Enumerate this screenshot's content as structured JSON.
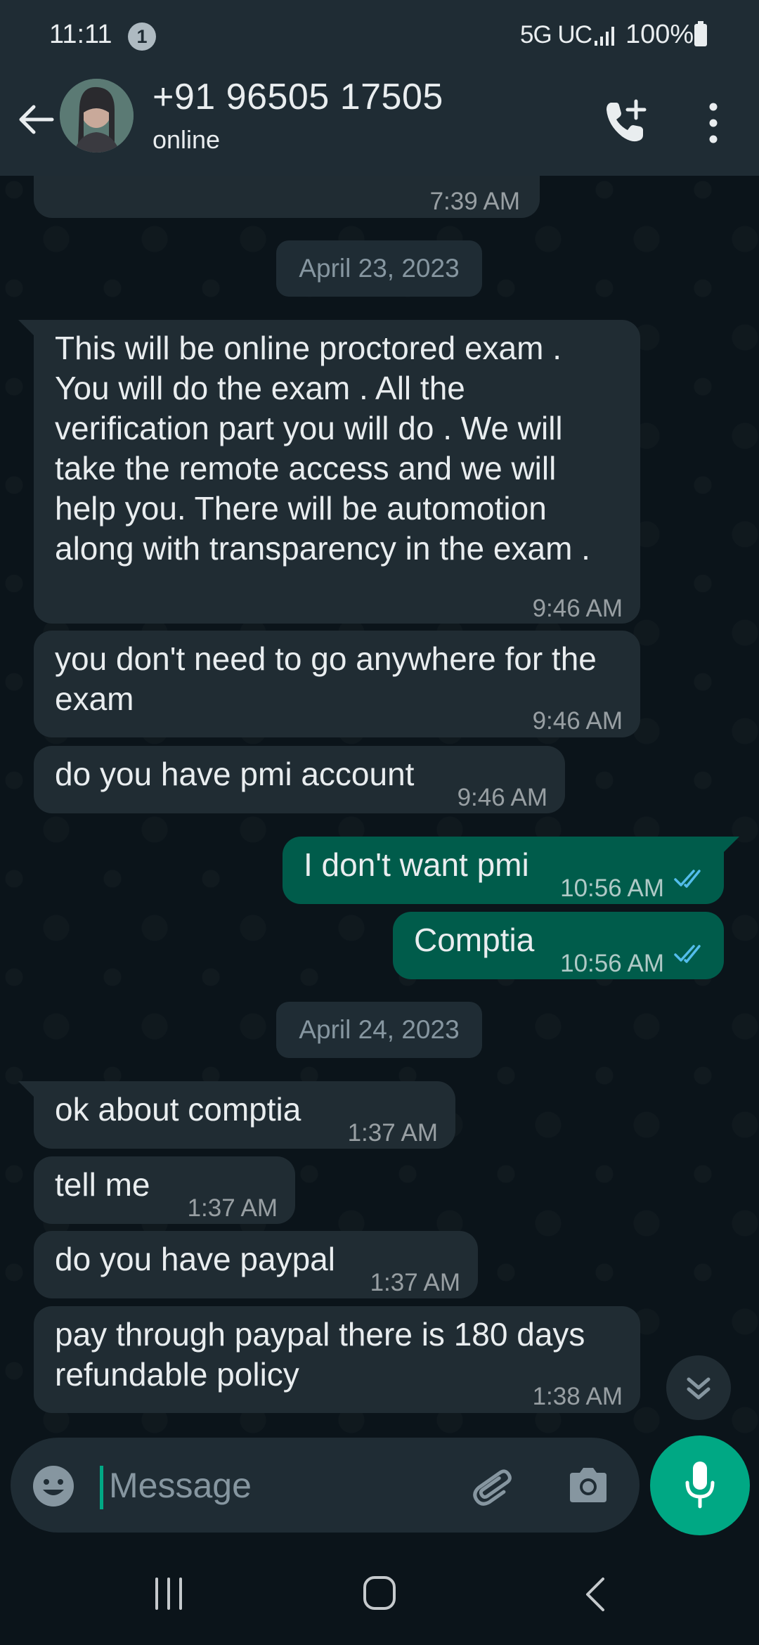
{
  "status_bar": {
    "time": "11:11",
    "notification_count": "1",
    "network": "5G UC",
    "battery": "100%"
  },
  "header": {
    "contact_name": "+91 96505 17505",
    "status": "online",
    "icons": [
      "back-arrow-icon",
      "avatar",
      "add-call-icon",
      "more-options-icon"
    ]
  },
  "chat": {
    "top_partial_time": "7:39 AM",
    "date_1": "April 23, 2023",
    "date_2": "April 24, 2023",
    "messages": [
      {
        "dir": "in",
        "text": "This will be online proctored exam .\nYou will do the exam . All the\nverification part you will do . We will\ntake the remote access and we will\nhelp you. There will be automotion\nalong with transparency in the exam .",
        "time": "9:46 AM"
      },
      {
        "dir": "in",
        "text": "you don't need to go anywhere for the\nexam",
        "time": "9:46 AM"
      },
      {
        "dir": "in",
        "text": "do you have pmi account",
        "time": "9:46 AM"
      },
      {
        "dir": "out",
        "text": "I don't want pmi",
        "time": "10:56 AM",
        "status": "read"
      },
      {
        "dir": "out",
        "text": "Comptia",
        "time": "10:56 AM",
        "status": "read"
      },
      {
        "dir": "in",
        "text": "ok about comptia",
        "time": "1:37 AM"
      },
      {
        "dir": "in",
        "text": "tell me",
        "time": "1:37 AM"
      },
      {
        "dir": "in",
        "text": "do you have paypal",
        "time": "1:37 AM"
      },
      {
        "dir": "in",
        "text": "pay through paypal there is 180 days\nrefundable policy",
        "time": "1:38 AM"
      }
    ]
  },
  "composer": {
    "placeholder": "Message",
    "icons": [
      "emoji-icon",
      "attach-icon",
      "camera-icon",
      "mic-icon"
    ]
  },
  "colors": {
    "background": "#0b141a",
    "bar": "#1f2c34",
    "incoming": "#202c33",
    "outgoing": "#005c4b",
    "accent": "#00a884",
    "read_ticks": "#53bdeb"
  }
}
